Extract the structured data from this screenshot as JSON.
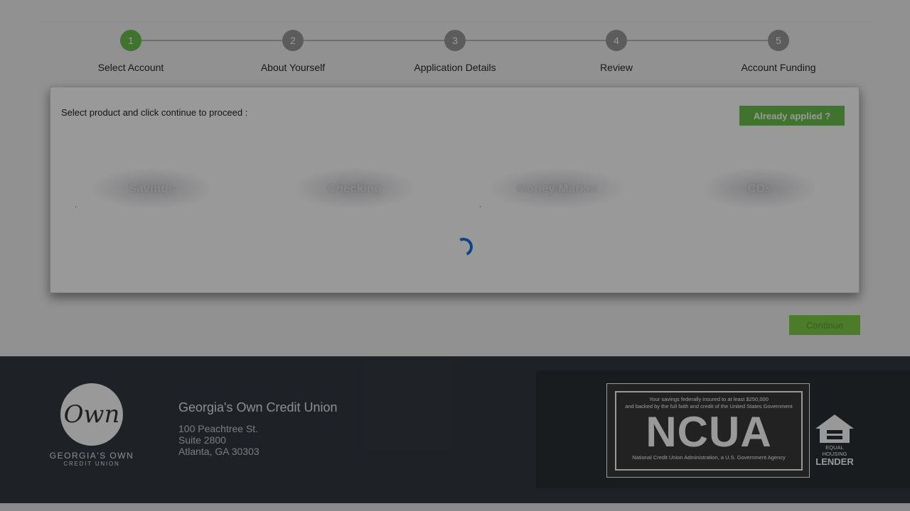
{
  "stepper": {
    "steps": [
      {
        "number": "1",
        "label": "Select Account",
        "state": "active"
      },
      {
        "number": "2",
        "label": "About Yourself",
        "state": "pending"
      },
      {
        "number": "3",
        "label": "Application Details",
        "state": "pending"
      },
      {
        "number": "4",
        "label": "Review",
        "state": "pending"
      },
      {
        "number": "5",
        "label": "Account Funding",
        "state": "pending"
      }
    ]
  },
  "selection": {
    "instruction": "Select product and click continue to proceed :",
    "already_applied_label": "Already applied ?",
    "products": [
      "Savings",
      "Checking",
      "Money Market",
      "CDs"
    ],
    "loading": true
  },
  "actions": {
    "continue_label": "Continue"
  },
  "footer": {
    "logo": {
      "mark": "Own",
      "name": "GEORGIA'S OWN",
      "sub": "CREDIT UNION"
    },
    "org_name": "Georgia's Own Credit Union",
    "address": [
      "100 Peachtree St.",
      "Suite 2800",
      "Atlanta, GA 30303"
    ],
    "ncua": {
      "top_line1": "Your savings federally insured to at least $250,000",
      "top_line2": "and backed by the full faith and credit of the United States Government",
      "big": "NCUA",
      "bottom": "National Credit Union Administration, a U.S. Government Agency"
    },
    "equal_housing": {
      "top": "EQUAL HOUSING",
      "big": "LENDER"
    }
  },
  "colors": {
    "accent": "#6bc04b",
    "step_inactive": "#9a9a9a",
    "spinner": "#1a6fe0",
    "footer_bg": "#333a42",
    "modal_overlay": "rgba(0,0,0,0.4)"
  }
}
